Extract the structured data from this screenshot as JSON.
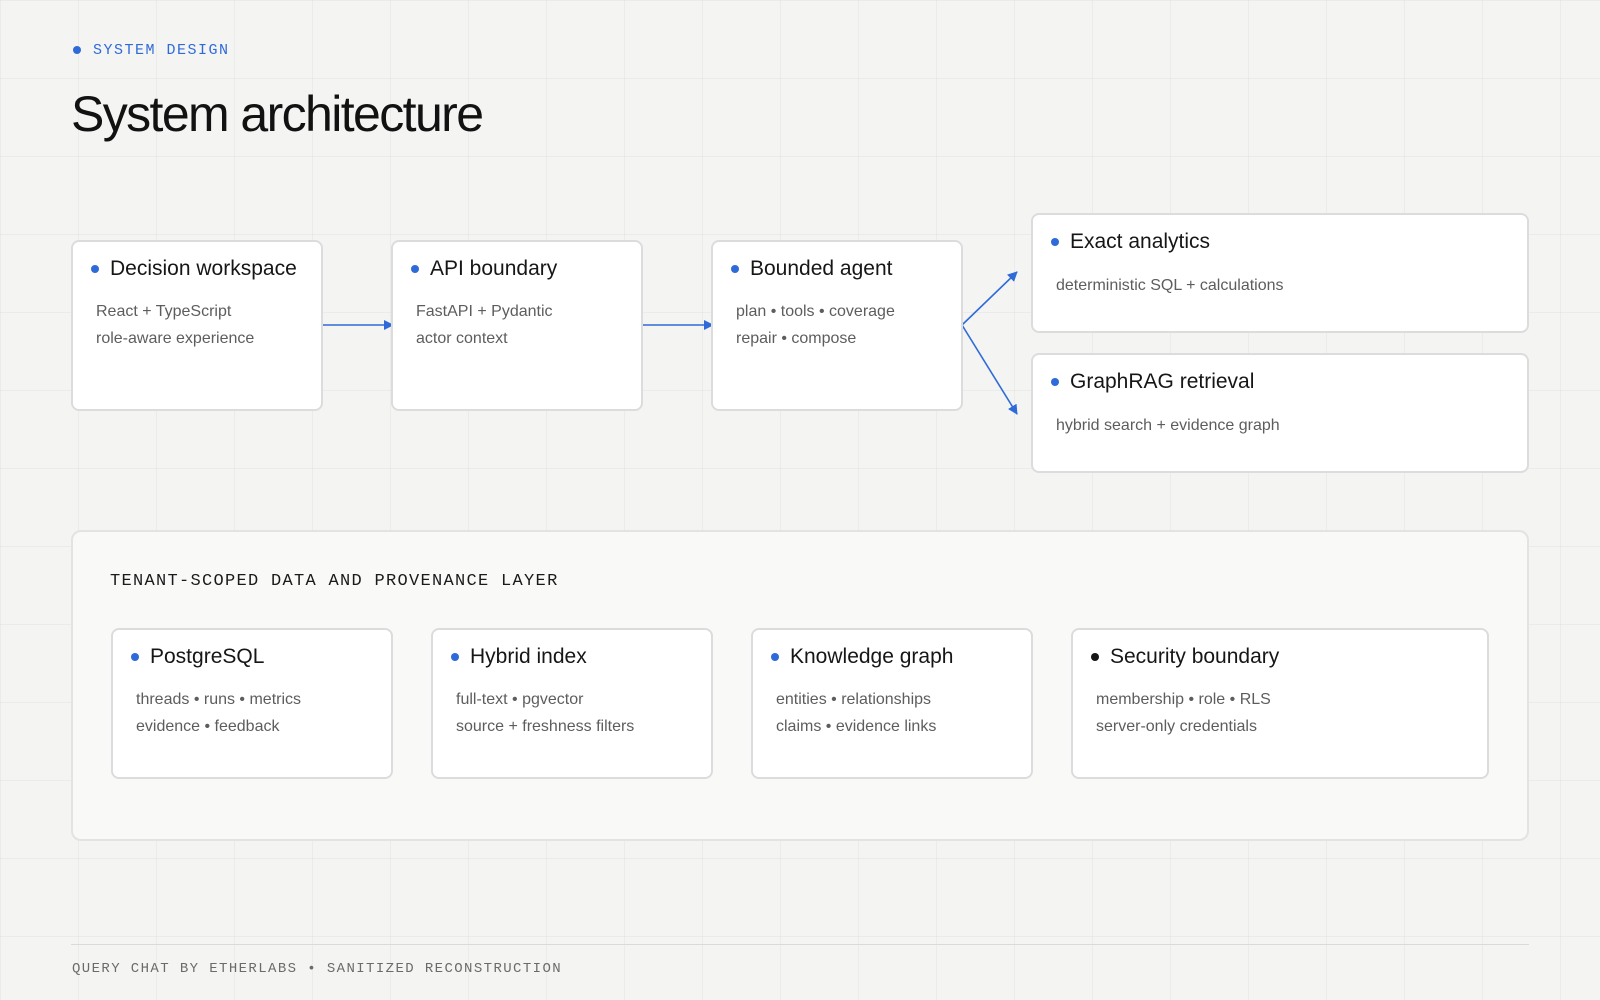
{
  "header": {
    "eyebrow": "SYSTEM DESIGN",
    "title": "System architecture"
  },
  "flow": {
    "decision_workspace": {
      "title": "Decision workspace",
      "lines": [
        "React + TypeScript",
        "role-aware experience"
      ]
    },
    "api_boundary": {
      "title": "API boundary",
      "lines": [
        "FastAPI + Pydantic",
        "actor context"
      ]
    },
    "bounded_agent": {
      "title": "Bounded agent",
      "lines": [
        "plan • tools • coverage",
        "repair • compose"
      ]
    },
    "exact_analytics": {
      "title": "Exact analytics",
      "lines": [
        "deterministic SQL + calculations"
      ]
    },
    "graphrag_retrieval": {
      "title": "GraphRAG retrieval",
      "lines": [
        "hybrid search + evidence graph"
      ]
    }
  },
  "data_layer": {
    "title": "TENANT-SCOPED DATA AND PROVENANCE LAYER",
    "postgresql": {
      "title": "PostgreSQL",
      "lines": [
        "threads • runs • metrics",
        "evidence • feedback"
      ]
    },
    "hybrid_index": {
      "title": "Hybrid index",
      "lines": [
        "full-text • pgvector",
        "source + freshness filters"
      ]
    },
    "knowledge_graph": {
      "title": "Knowledge graph",
      "lines": [
        "entities • relationships",
        "claims • evidence links"
      ]
    },
    "security_boundary": {
      "title": "Security boundary",
      "lines": [
        "membership • role • RLS",
        "server-only credentials"
      ]
    }
  },
  "footer": {
    "text": "QUERY CHAT BY ETHERLABS • SANITIZED RECONSTRUCTION"
  },
  "colors": {
    "accent": "#2f6bd8",
    "text": "#161616",
    "muted": "#5d5d5d",
    "background": "#f4f4f3"
  }
}
